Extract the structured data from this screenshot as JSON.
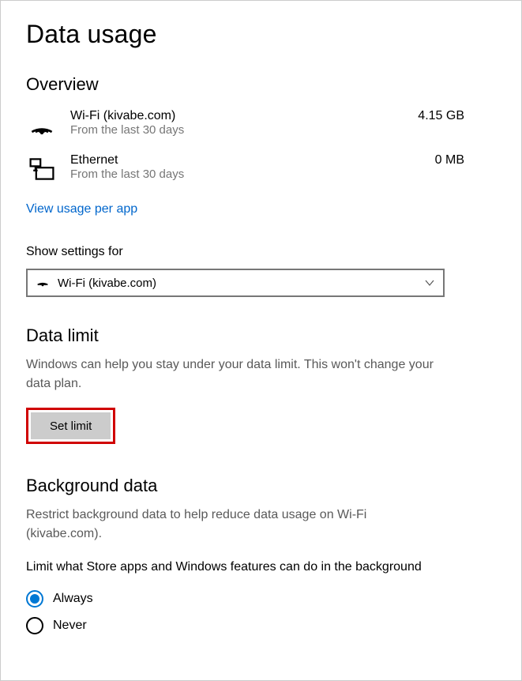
{
  "page_title": "Data usage",
  "overview": {
    "heading": "Overview",
    "adapters": [
      {
        "name": "Wi-Fi (kivabe.com)",
        "sub": "From the last 30 days",
        "usage": "4.15 GB"
      },
      {
        "name": "Ethernet",
        "sub": "From the last 30 days",
        "usage": "0 MB"
      }
    ],
    "link": "View usage per app"
  },
  "show_settings": {
    "label": "Show settings for",
    "selected": "Wi-Fi (kivabe.com)"
  },
  "data_limit": {
    "heading": "Data limit",
    "body": "Windows can help you stay under your data limit. This won't change your data plan.",
    "button": "Set limit"
  },
  "background_data": {
    "heading": "Background data",
    "body": "Restrict background data to help reduce data usage on Wi-Fi (kivabe.com).",
    "question": "Limit what Store apps and Windows features can do in the background",
    "options": {
      "always": "Always",
      "never": "Never"
    }
  }
}
